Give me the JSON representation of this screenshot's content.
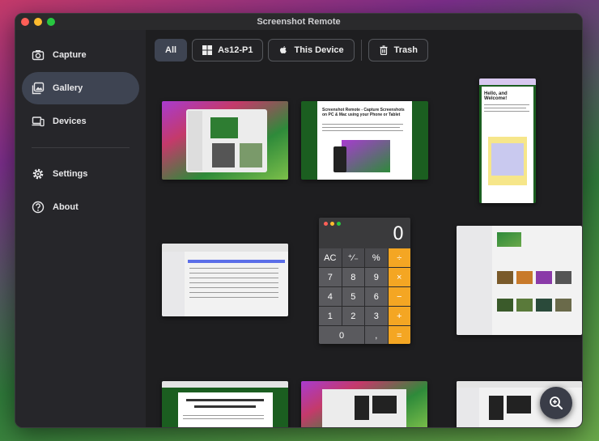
{
  "window": {
    "title": "Screenshot Remote"
  },
  "sidebar": {
    "items": [
      {
        "label": "Capture",
        "icon": "camera-icon"
      },
      {
        "label": "Gallery",
        "icon": "gallery-icon",
        "active": true
      },
      {
        "label": "Devices",
        "icon": "devices-icon"
      }
    ],
    "secondary": [
      {
        "label": "Settings",
        "icon": "gear-icon"
      },
      {
        "label": "About",
        "icon": "help-icon"
      }
    ]
  },
  "filters": {
    "all": "All",
    "device1": "As12-P1",
    "this_device": "This Device",
    "trash": "Trash"
  },
  "gallery": {
    "doc_heading": "Screenshot Remote - Capture Screenshots on PC & Mac using your Phone or Tablet",
    "hello_heading": "Hello, and Welcome!",
    "calculator": {
      "display": "0",
      "keys": [
        "AC",
        "⁺∕₋",
        "%",
        "÷",
        "7",
        "8",
        "9",
        "×",
        "4",
        "5",
        "6",
        "−",
        "1",
        "2",
        "3",
        "+",
        "0",
        ",",
        "="
      ]
    }
  },
  "colors": {
    "accent": "#3e4452",
    "calc_op": "#f4a623"
  }
}
